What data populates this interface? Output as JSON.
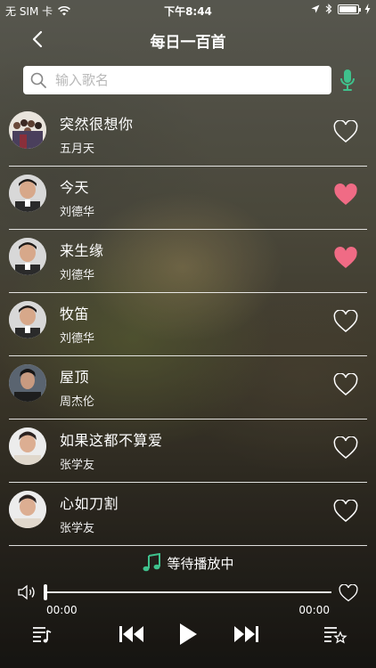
{
  "status_bar": {
    "carrier": "无 SIM 卡",
    "time": "下午8:44"
  },
  "nav": {
    "title": "每日一百首"
  },
  "search": {
    "placeholder": "输入歌名"
  },
  "songs": [
    {
      "name": "突然很想你",
      "artist": "五月天",
      "liked": false
    },
    {
      "name": "今天",
      "artist": "刘德华",
      "liked": true
    },
    {
      "name": "来生缘",
      "artist": "刘德华",
      "liked": true
    },
    {
      "name": "牧笛",
      "artist": "刘德华",
      "liked": false
    },
    {
      "name": "屋顶",
      "artist": "周杰伦",
      "liked": false
    },
    {
      "name": "如果这都不算爱",
      "artist": "张学友",
      "liked": false
    },
    {
      "name": "心如刀割",
      "artist": "张学友",
      "liked": false
    }
  ],
  "player": {
    "status": "等待播放中",
    "current_time": "00:00",
    "total_time": "00:00",
    "progress": 0
  },
  "colors": {
    "accent_green": "#3fc18c",
    "liked_pink": "#f06b85"
  }
}
